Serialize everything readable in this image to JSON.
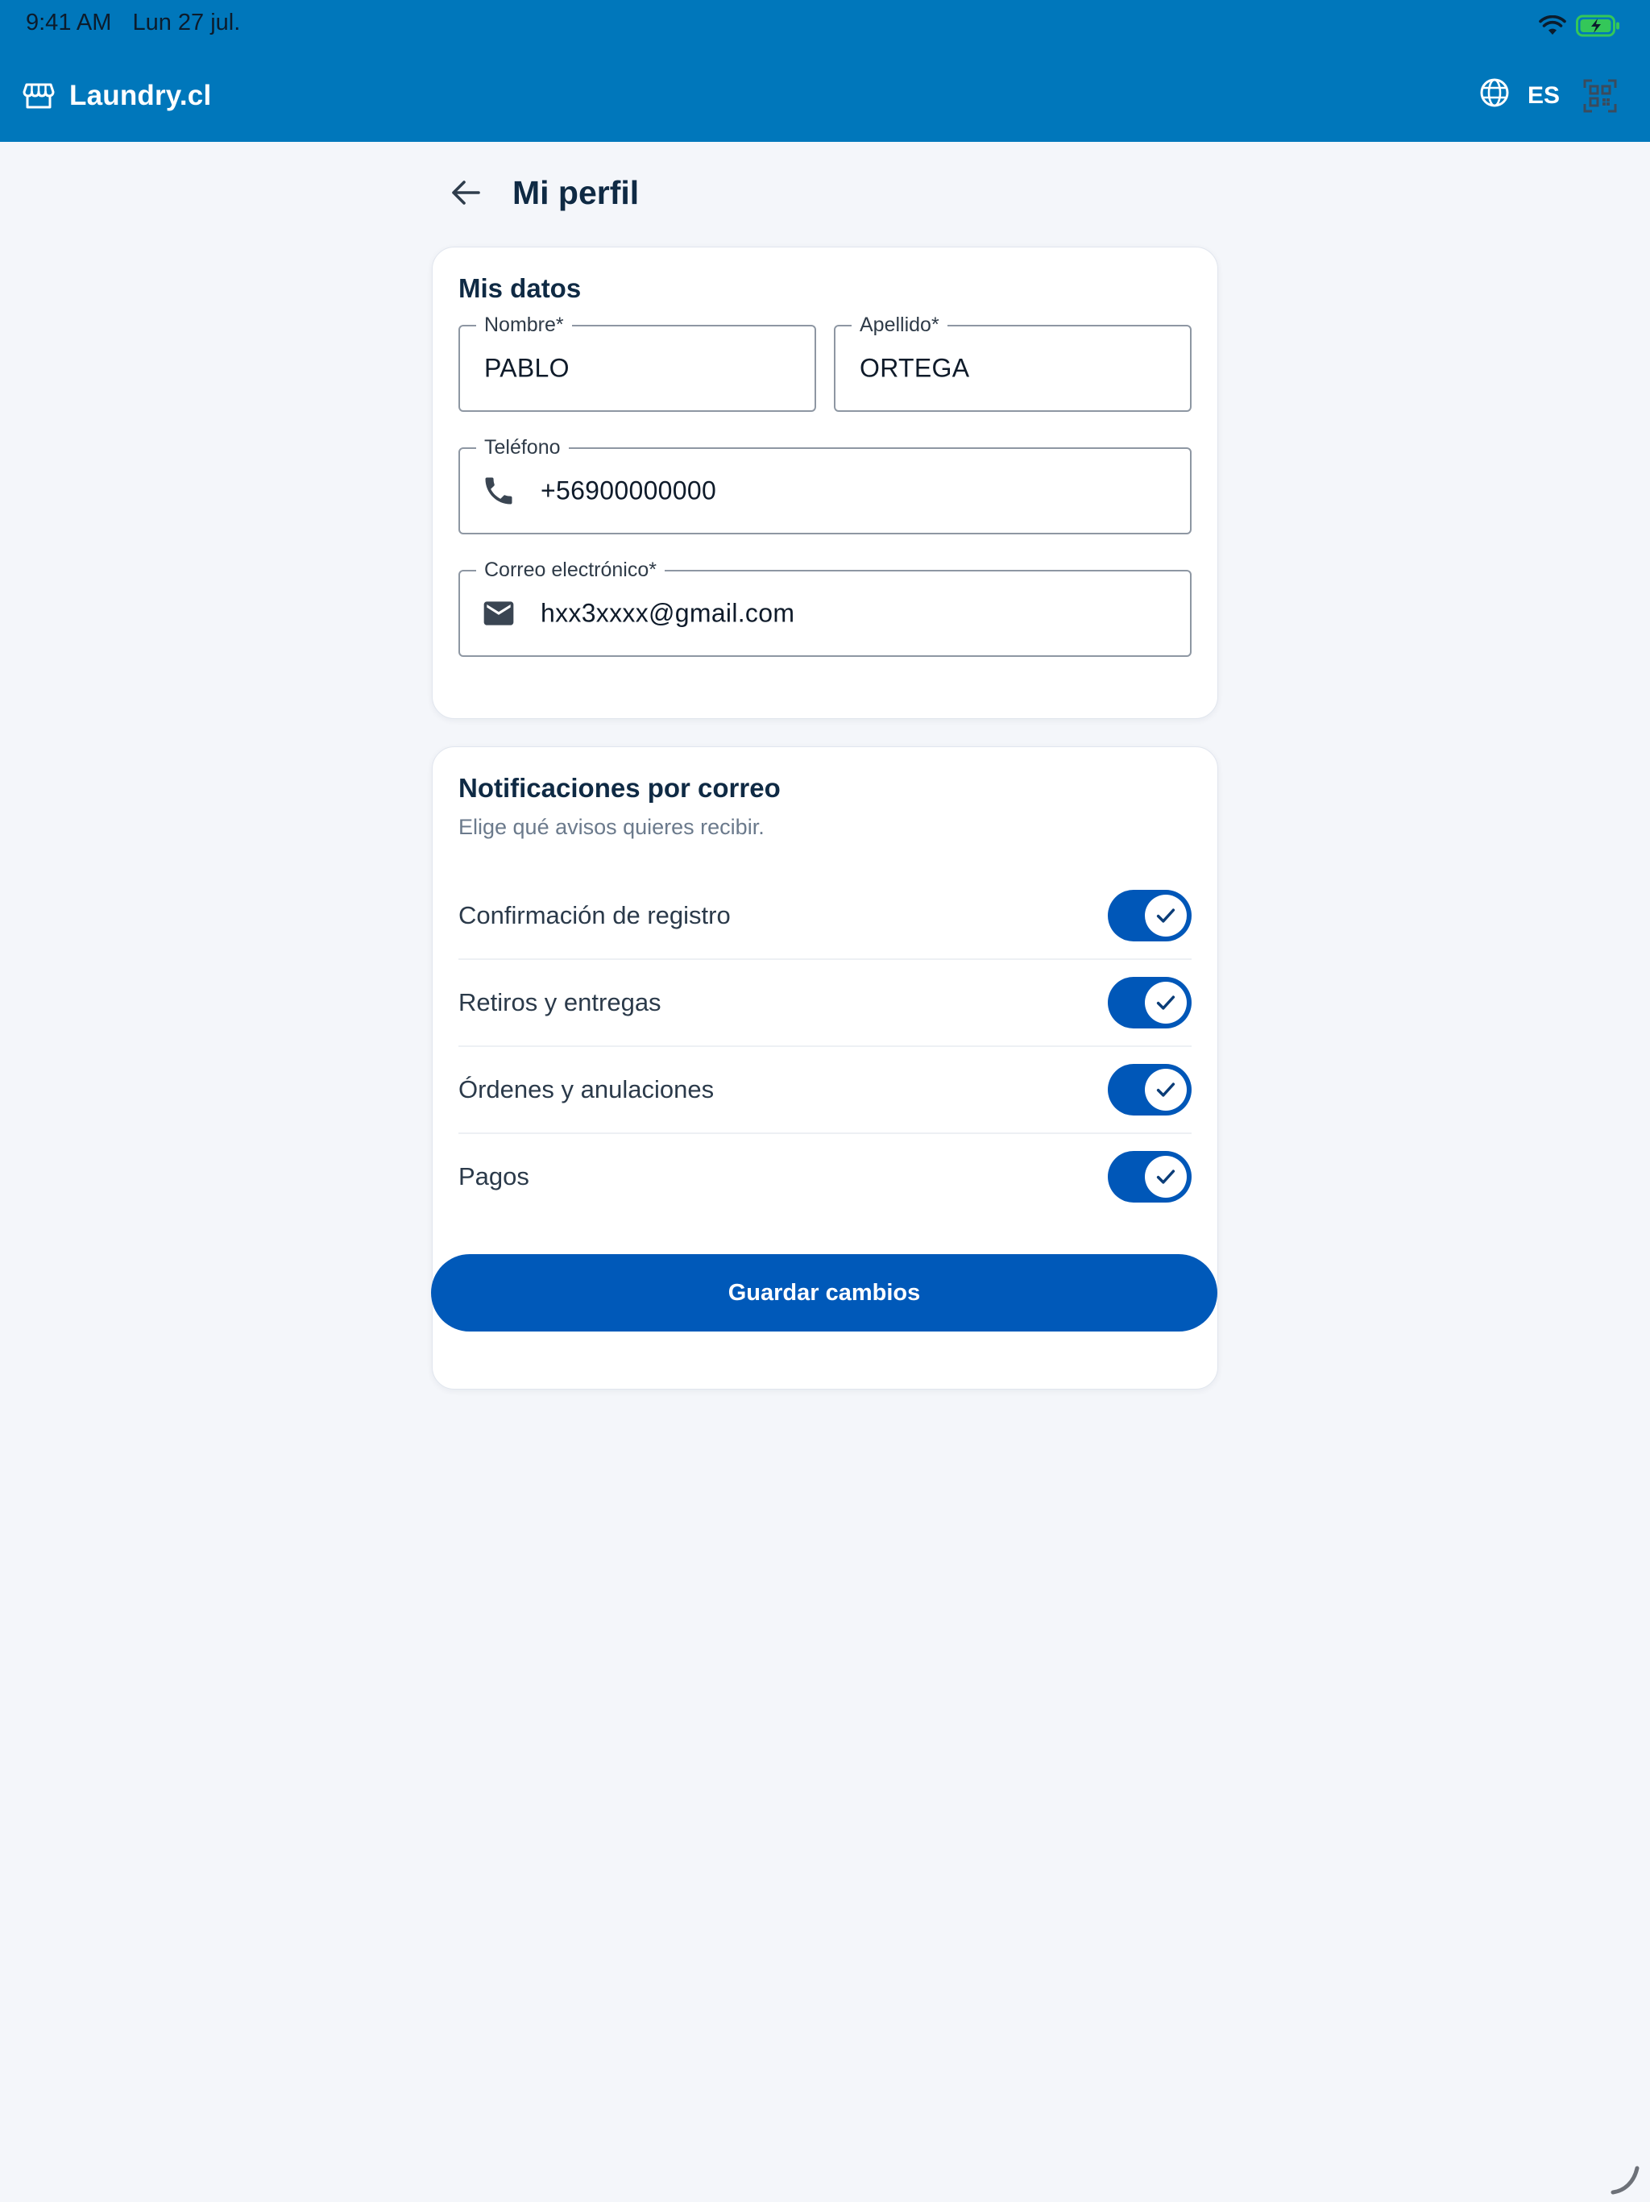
{
  "status_bar": {
    "time": "9:41 AM",
    "date": "Lun 27 jul.",
    "wifi_icon": "wifi-icon",
    "battery_icon": "battery-charging-icon",
    "battery_color": "#34c759"
  },
  "app_bar": {
    "brand": "Laundry.cl",
    "store_icon": "store-icon",
    "language": "ES",
    "globe_icon": "globe-icon",
    "qr_icon": "qr-scan-icon",
    "background_color": "#0077bb"
  },
  "page": {
    "title": "Mi perfil",
    "back_icon": "arrow-left-icon"
  },
  "profile": {
    "title": "Mis datos",
    "fields": {
      "nombre": {
        "label": "Nombre*",
        "value": "PABLO"
      },
      "apellido": {
        "label": "Apellido*",
        "value": "ORTEGA"
      },
      "telefono": {
        "label": "Teléfono",
        "value": "+56900000000",
        "icon": "phone-icon"
      },
      "correo": {
        "label": "Correo electrónico*",
        "value": "hxx3xxxx@gmail.com",
        "icon": "mail-icon"
      }
    }
  },
  "notifications": {
    "title": "Notificaciones por correo",
    "subtitle": "Elige qué avisos quieres recibir.",
    "items": [
      {
        "label": "Confirmación de registro",
        "enabled": true
      },
      {
        "label": "Retiros y entregas",
        "enabled": true
      },
      {
        "label": "Órdenes y anulaciones",
        "enabled": true
      },
      {
        "label": "Pagos",
        "enabled": true
      }
    ],
    "toggle_color": "#0057b8"
  },
  "actions": {
    "save_label": "Guardar cambios",
    "save_color": "#0059b9"
  }
}
